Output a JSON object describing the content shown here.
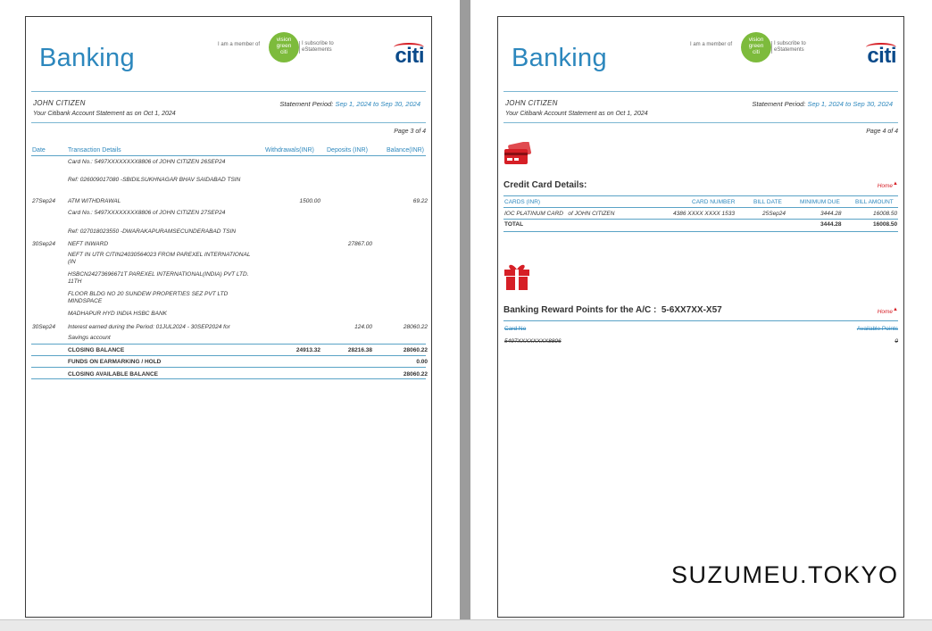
{
  "header": {
    "brand": "Banking",
    "member_text": "I am a member of",
    "badge_lines": [
      "vision",
      "green",
      "citi"
    ],
    "subscribe_lines": [
      "I subscribe to",
      "eStatements"
    ],
    "citi_logo": "citi",
    "customer_name": "JOHN CITIZEN",
    "statement_as_of": "Your Citibank Account Statement as on Oct 1, 2024",
    "period_label": "Statement Period:",
    "period_value": "Sep 1, 2024 to Sep 30, 2024"
  },
  "page1": {
    "page_no": "Page 3 of 4",
    "columns": [
      "Date",
      "Transaction Details",
      "Withdrawals(INR)",
      "Deposits (INR)",
      "Balance(INR)"
    ],
    "rows": [
      {
        "date": "",
        "details": "Card No.: 5497XXXXXXXX8806 of JOHN CITIZEN 26SEP24",
        "wd": "",
        "dep": "",
        "bal": ""
      },
      {
        "date": "",
        "details": "Ref: 026009017080 -SBIDILSUKHNAGAR BHAV SAIDABAD TSIN",
        "wd": "",
        "dep": "",
        "bal": ""
      },
      {
        "date": "27Sep24",
        "details": "ATM WITHDRAWAL",
        "wd": "1500.00",
        "dep": "",
        "bal": "69.22"
      },
      {
        "date": "",
        "details": "Card No.: 5497XXXXXXXX8806 of JOHN CITIZEN 27SEP24",
        "wd": "",
        "dep": "",
        "bal": ""
      },
      {
        "date": "",
        "details": "Ref: 027018023550 -DWARAKAPURAMSECUNDERABAD TSIN",
        "wd": "",
        "dep": "",
        "bal": ""
      },
      {
        "date": "30Sep24",
        "details": "NEFT INWARD",
        "wd": "",
        "dep": "27867.00",
        "bal": ""
      },
      {
        "date": "",
        "details": "NEFT IN UTR CITIN24030564023 FROM PAREXEL INTERNATIONAL (IN",
        "wd": "",
        "dep": "",
        "bal": ""
      },
      {
        "date": "",
        "details": "HSBCN24273696671T PAREXEL INTERNATIONAL(INDIA) PVT LTD. 11TH",
        "wd": "",
        "dep": "",
        "bal": ""
      },
      {
        "date": "",
        "details": "FLOOR BLDG NO 20 SUNDEW PROPERTIES SEZ PVT LTD MINDSPACE",
        "wd": "",
        "dep": "",
        "bal": ""
      },
      {
        "date": "",
        "details": "MADHAPUR HYD INDIA HSBC BANK",
        "wd": "",
        "dep": "",
        "bal": ""
      },
      {
        "date": "30Sep24",
        "details": "Interest earned during the Period: 01JUL2024 - 30SEP2024 for",
        "wd": "",
        "dep": "124.00",
        "bal": "28060.22"
      },
      {
        "date": "",
        "details": "Savings account",
        "wd": "",
        "dep": "",
        "bal": ""
      }
    ],
    "summary": [
      {
        "label": "CLOSING BALANCE",
        "wd": "24913.32",
        "dep": "28216.38",
        "bal": "28060.22"
      },
      {
        "label": "FUNDS ON EARMARKING / HOLD",
        "wd": "",
        "dep": "",
        "bal": "0.00"
      },
      {
        "label": "CLOSING AVAILABLE BALANCE",
        "wd": "",
        "dep": "",
        "bal": "28060.22"
      }
    ]
  },
  "page2": {
    "page_no": "Page 4 of 4",
    "cc_title": "Credit Card Details:",
    "home": "Home",
    "cc_columns": [
      "CARDS (INR)",
      "CARD NUMBER",
      "BILL DATE",
      "MINIMUM DUE",
      "BILL AMOUNT"
    ],
    "cc_row": {
      "card": "IOC PLATINUM CARD",
      "of": "of JOHN CITIZEN",
      "number": "4386 XXXX XXXX 1533",
      "bill_date": "25Sep24",
      "min_due": "3444.28",
      "amount": "16008.50"
    },
    "cc_total": {
      "label": "TOTAL",
      "min_due": "3444.28",
      "amount": "16008.50"
    },
    "reward_title": "Banking Reward Points for the A/C :",
    "reward_account": "5-6XX7XX-X57",
    "reward_columns": [
      "Card No",
      "Available Points"
    ],
    "reward_row": {
      "card": "5497XXXXXXXX8806",
      "points": "0"
    }
  },
  "watermark": "SUZUMEU.TOKYO",
  "colors": {
    "accent": "#2c87bd",
    "citi_blue": "#0a4a8a",
    "red": "#d61f26",
    "green": "#7dbb3c"
  }
}
